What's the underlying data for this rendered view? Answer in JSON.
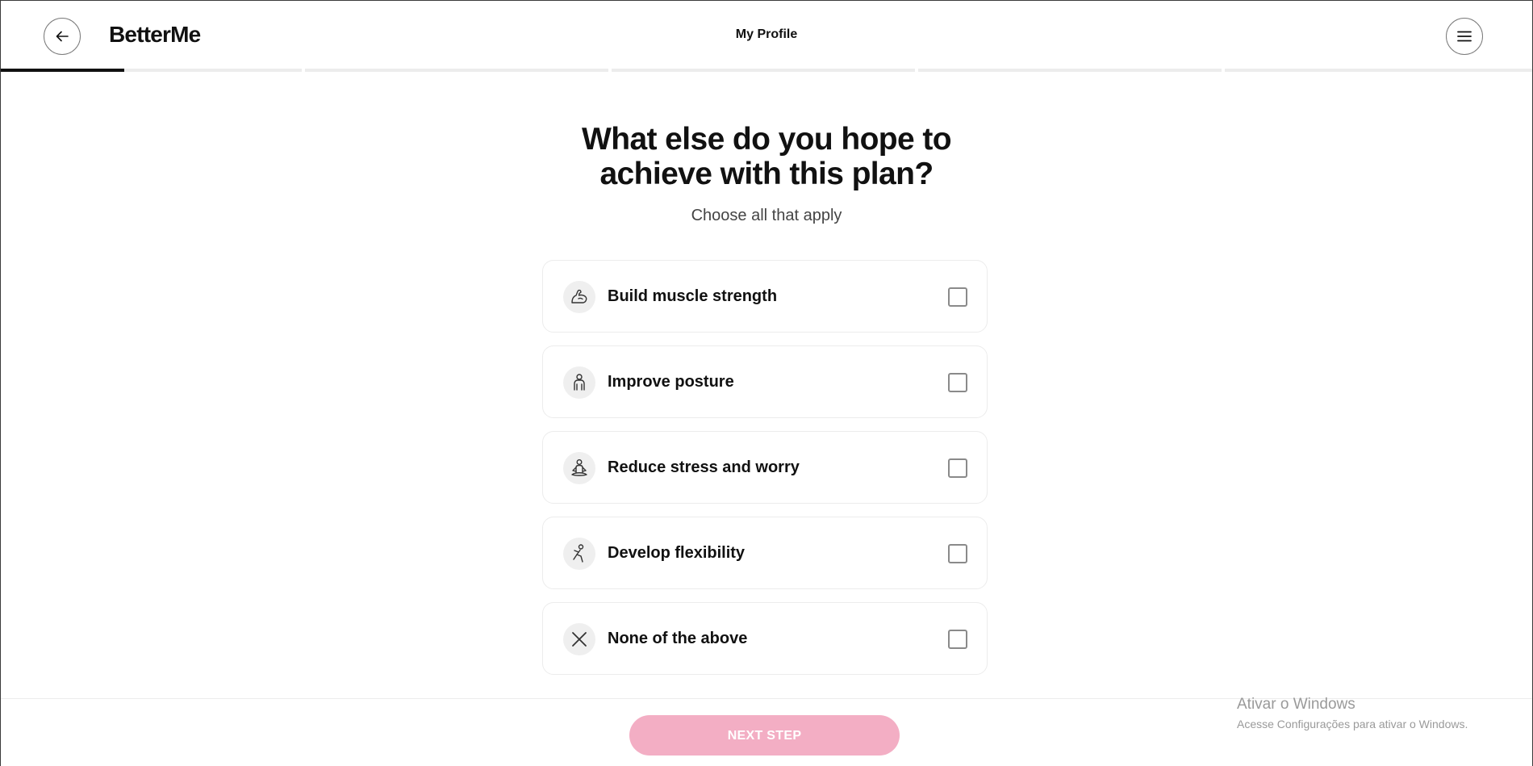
{
  "app": {
    "logo": "BetterMe"
  },
  "header": {
    "title": "My Profile",
    "back_icon": "arrow-left-icon",
    "menu_icon": "hamburger-menu-icon"
  },
  "progress": {
    "steps": 5,
    "current_step": 1,
    "current_step_fill": 0.41
  },
  "question": {
    "line1": "What else do you hope to",
    "line2": "achieve with this plan?",
    "subtitle": "Choose all that apply"
  },
  "options": [
    {
      "label": "Build muscle strength",
      "icon": "flexed-arm-icon",
      "checked": false
    },
    {
      "label": "Improve posture",
      "icon": "person-posture-icon",
      "checked": false
    },
    {
      "label": "Reduce stress and worry",
      "icon": "meditation-icon",
      "checked": false
    },
    {
      "label": "Develop flexibility",
      "icon": "stretching-person-icon",
      "checked": false
    },
    {
      "label": "None of the above",
      "icon": "close-x-icon",
      "checked": false
    }
  ],
  "footer": {
    "next_label": "NEXT STEP",
    "next_enabled": false
  },
  "os_watermark": {
    "title": "Ativar o Windows",
    "subtitle": "Acesse Configurações para ativar o Windows."
  },
  "colors": {
    "accent_disabled": "#f3aec4",
    "progress_active": "#111111",
    "progress_inactive": "#ececec",
    "icon_bg": "#efefef"
  }
}
